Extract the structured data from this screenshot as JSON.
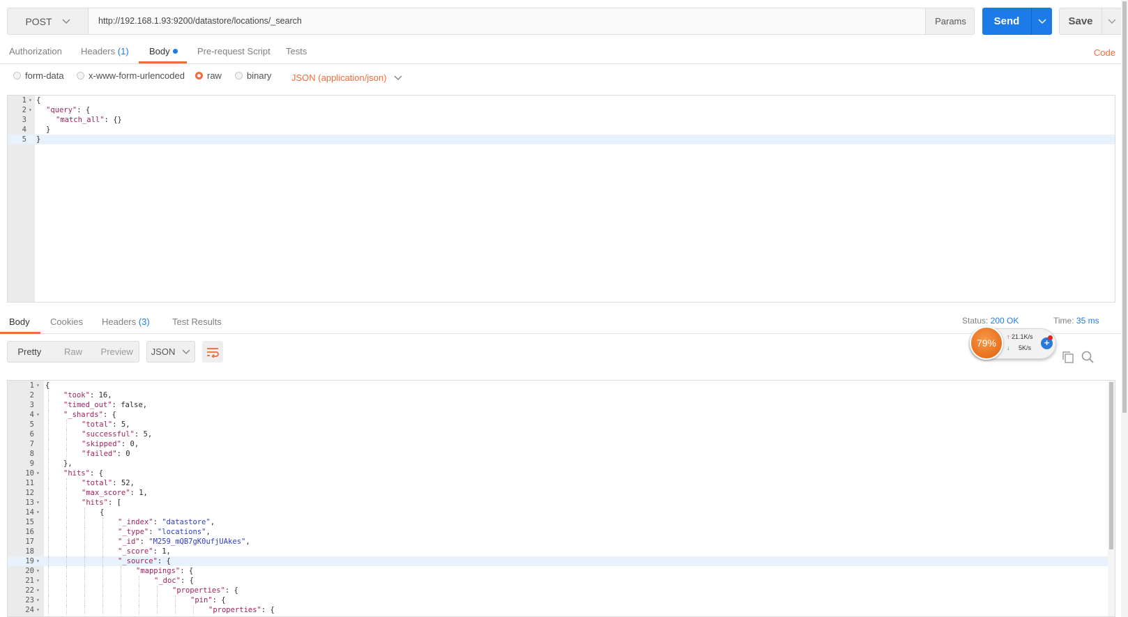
{
  "request": {
    "method": "POST",
    "url": "http://192.168.1.93:9200/datastore/locations/_search",
    "params_label": "Params",
    "send_label": "Send",
    "save_label": "Save"
  },
  "request_tabs": {
    "authorization": "Authorization",
    "headers": "Headers",
    "headers_count": "(1)",
    "body": "Body",
    "prerequest": "Pre-request Script",
    "tests": "Tests",
    "code_link": "Code"
  },
  "body_types": {
    "form_data": "form-data",
    "urlencoded": "x-www-form-urlencoded",
    "raw": "raw",
    "binary": "binary",
    "selected": "raw",
    "content_type": "JSON (application/json)"
  },
  "request_body": {
    "lines": [
      {
        "n": "1",
        "fold": true,
        "indent": 0,
        "segs": [
          [
            "p",
            "{"
          ]
        ]
      },
      {
        "n": "2",
        "fold": true,
        "indent": 1,
        "segs": [
          [
            "k",
            "\"query\""
          ],
          [
            "p",
            ": {"
          ]
        ]
      },
      {
        "n": "3",
        "fold": false,
        "indent": 2,
        "segs": [
          [
            "k",
            "\"match_all\""
          ],
          [
            "p",
            ": {}"
          ]
        ]
      },
      {
        "n": "4",
        "fold": false,
        "indent": 1,
        "segs": [
          [
            "p",
            "}"
          ]
        ]
      },
      {
        "n": "5",
        "fold": false,
        "indent": 0,
        "segs": [
          [
            "p",
            "}"
          ]
        ],
        "active": true
      }
    ]
  },
  "response_tabs": {
    "body": "Body",
    "cookies": "Cookies",
    "headers": "Headers",
    "headers_count": "(3)",
    "test_results": "Test Results"
  },
  "response_meta": {
    "status_label": "Status:",
    "status_value": "200 OK",
    "time_label": "Time:",
    "time_value": "35 ms"
  },
  "response_view": {
    "pretty": "Pretty",
    "raw": "Raw",
    "preview": "Preview",
    "format": "JSON"
  },
  "net_widget": {
    "percent": "79%",
    "upload": "21.1K/s",
    "download": "5K/s"
  },
  "response_body": {
    "lines": [
      {
        "n": "1",
        "fold": true,
        "indent": 0,
        "segs": [
          [
            "p",
            "{"
          ]
        ]
      },
      {
        "n": "2",
        "fold": false,
        "indent": 1,
        "segs": [
          [
            "k",
            "\"took\""
          ],
          [
            "p",
            ": 16,"
          ]
        ]
      },
      {
        "n": "3",
        "fold": false,
        "indent": 1,
        "segs": [
          [
            "k",
            "\"timed_out\""
          ],
          [
            "p",
            ": false,"
          ]
        ]
      },
      {
        "n": "4",
        "fold": true,
        "indent": 1,
        "segs": [
          [
            "k",
            "\"_shards\""
          ],
          [
            "p",
            ": {"
          ]
        ]
      },
      {
        "n": "5",
        "fold": false,
        "indent": 2,
        "segs": [
          [
            "k",
            "\"total\""
          ],
          [
            "p",
            ": 5,"
          ]
        ]
      },
      {
        "n": "6",
        "fold": false,
        "indent": 2,
        "segs": [
          [
            "k",
            "\"successful\""
          ],
          [
            "p",
            ": 5,"
          ]
        ]
      },
      {
        "n": "7",
        "fold": false,
        "indent": 2,
        "segs": [
          [
            "k",
            "\"skipped\""
          ],
          [
            "p",
            ": 0,"
          ]
        ]
      },
      {
        "n": "8",
        "fold": false,
        "indent": 2,
        "segs": [
          [
            "k",
            "\"failed\""
          ],
          [
            "p",
            ": 0"
          ]
        ]
      },
      {
        "n": "9",
        "fold": false,
        "indent": 1,
        "segs": [
          [
            "p",
            "},"
          ]
        ]
      },
      {
        "n": "10",
        "fold": true,
        "indent": 1,
        "segs": [
          [
            "k",
            "\"hits\""
          ],
          [
            "p",
            ": {"
          ]
        ]
      },
      {
        "n": "11",
        "fold": false,
        "indent": 2,
        "segs": [
          [
            "k",
            "\"total\""
          ],
          [
            "p",
            ": 52,"
          ]
        ]
      },
      {
        "n": "12",
        "fold": false,
        "indent": 2,
        "segs": [
          [
            "k",
            "\"max_score\""
          ],
          [
            "p",
            ": 1,"
          ]
        ]
      },
      {
        "n": "13",
        "fold": true,
        "indent": 2,
        "segs": [
          [
            "k",
            "\"hits\""
          ],
          [
            "p",
            ": ["
          ]
        ]
      },
      {
        "n": "14",
        "fold": true,
        "indent": 3,
        "segs": [
          [
            "p",
            "{"
          ]
        ]
      },
      {
        "n": "15",
        "fold": false,
        "indent": 4,
        "segs": [
          [
            "k",
            "\"_index\""
          ],
          [
            "p",
            ": "
          ],
          [
            "s",
            "\"datastore\""
          ],
          [
            "p",
            ","
          ]
        ]
      },
      {
        "n": "16",
        "fold": false,
        "indent": 4,
        "segs": [
          [
            "k",
            "\"_type\""
          ],
          [
            "p",
            ": "
          ],
          [
            "s",
            "\"locations\""
          ],
          [
            "p",
            ","
          ]
        ]
      },
      {
        "n": "17",
        "fold": false,
        "indent": 4,
        "segs": [
          [
            "k",
            "\"_id\""
          ],
          [
            "p",
            ": "
          ],
          [
            "s",
            "\"M259_mQB7gK0ufjUAkes\""
          ],
          [
            "p",
            ","
          ]
        ]
      },
      {
        "n": "18",
        "fold": false,
        "indent": 4,
        "segs": [
          [
            "k",
            "\"_score\""
          ],
          [
            "p",
            ": 1,"
          ]
        ]
      },
      {
        "n": "19",
        "fold": true,
        "indent": 4,
        "segs": [
          [
            "k",
            "\"_source\""
          ],
          [
            "p",
            ": {"
          ]
        ],
        "active": true
      },
      {
        "n": "20",
        "fold": true,
        "indent": 5,
        "segs": [
          [
            "k",
            "\"mappings\""
          ],
          [
            "p",
            ": {"
          ]
        ]
      },
      {
        "n": "21",
        "fold": true,
        "indent": 6,
        "segs": [
          [
            "k",
            "\"_doc\""
          ],
          [
            "p",
            ": {"
          ]
        ]
      },
      {
        "n": "22",
        "fold": true,
        "indent": 7,
        "segs": [
          [
            "k",
            "\"properties\""
          ],
          [
            "p",
            ": {"
          ]
        ]
      },
      {
        "n": "23",
        "fold": true,
        "indent": 8,
        "segs": [
          [
            "k",
            "\"pin\""
          ],
          [
            "p",
            ": {"
          ]
        ]
      },
      {
        "n": "24",
        "fold": true,
        "indent": 9,
        "segs": [
          [
            "k",
            "\"properties\""
          ],
          [
            "p",
            ": {"
          ]
        ]
      }
    ]
  },
  "colors": {
    "accent": "#f26b3a",
    "primary": "#1c7be9",
    "json_key": "#a0235f",
    "json_string": "#2f3dc2"
  }
}
